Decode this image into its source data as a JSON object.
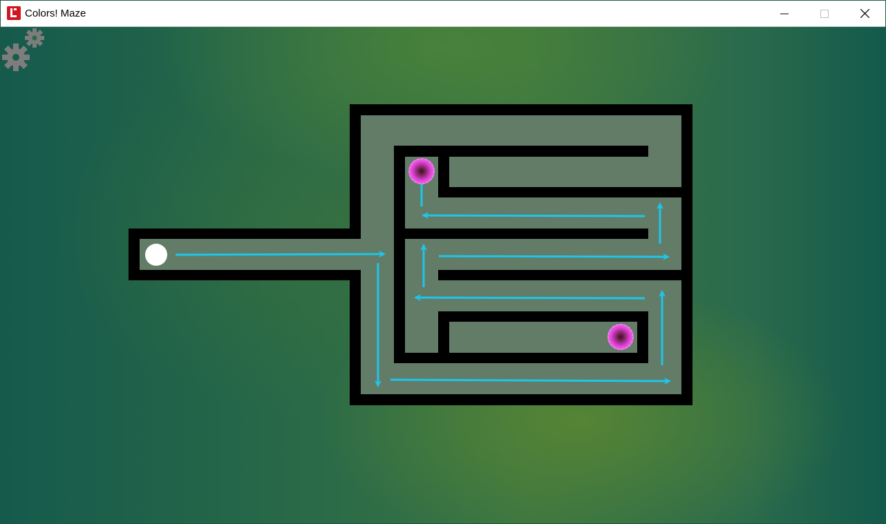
{
  "window": {
    "title": "Colors! Maze",
    "app_icon": "colors-app-icon",
    "controls": [
      "minimize-icon",
      "maximize-icon",
      "close-icon"
    ]
  },
  "toolbar": {
    "settings_icon": "gears-icon"
  },
  "game": {
    "colors": {
      "wall": "#000000",
      "path": "#627c68",
      "arrow": "#1ec6ea",
      "player": "#ffffff",
      "portal": "#e040d8",
      "portal_core": "#5a1a3c"
    },
    "pieces": {
      "player": "white-ball",
      "goals": [
        "pink-portal",
        "pink-portal"
      ]
    }
  }
}
